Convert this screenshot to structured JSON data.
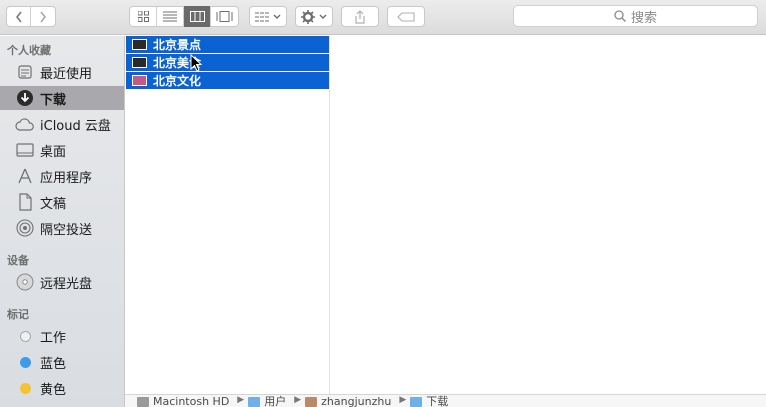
{
  "toolbar": {
    "search_placeholder": "搜索",
    "back_icon": "chevron-left-icon",
    "forward_icon": "chevron-right-icon",
    "view_modes": [
      "icon-view",
      "list-view",
      "column-view",
      "gallery-view"
    ],
    "active_view": "column-view"
  },
  "sidebar": {
    "favorites_heading": "个人收藏",
    "favorites": [
      {
        "label": "最近使用",
        "icon": "recent-icon"
      },
      {
        "label": "下载",
        "icon": "download-icon",
        "selected": true
      },
      {
        "label": "iCloud 云盘",
        "icon": "cloud-icon"
      },
      {
        "label": "桌面",
        "icon": "desktop-icon"
      },
      {
        "label": "应用程序",
        "icon": "applications-icon"
      },
      {
        "label": "文稿",
        "icon": "documents-icon"
      },
      {
        "label": "隔空投送",
        "icon": "airdrop-icon"
      }
    ],
    "devices_heading": "设备",
    "devices": [
      {
        "label": "远程光盘",
        "icon": "remote-disc-icon"
      }
    ],
    "tags_heading": "标记",
    "tags": [
      {
        "label": "工作",
        "color": "#ffffff"
      },
      {
        "label": "蓝色",
        "color": "#3d9be9"
      },
      {
        "label": "黄色",
        "color": "#f4c430"
      }
    ]
  },
  "files": [
    {
      "name": "北京景点",
      "icon": "image-file-icon"
    },
    {
      "name": "北京美食",
      "icon": "image-file-icon"
    },
    {
      "name": "北京文化",
      "icon": "image-file-icon"
    }
  ],
  "pathbar": {
    "items": [
      "Macintosh HD",
      "用户",
      "zhangjunzhu",
      "下载"
    ]
  },
  "colors": {
    "selection": "#0a62d3",
    "sidebar_selected": "#a9a9ad"
  }
}
